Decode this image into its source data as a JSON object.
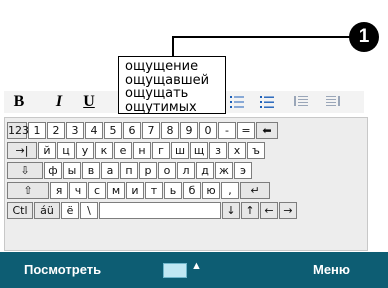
{
  "callout": {
    "number": "1"
  },
  "toolbar": {
    "bold": "B",
    "italic": "I",
    "underline": "U"
  },
  "suggestions": [
    "ощущение",
    "ощущавшей",
    "ощущать",
    "ощутимых"
  ],
  "keyboard": {
    "row1": [
      "123",
      "1",
      "2",
      "3",
      "4",
      "5",
      "6",
      "7",
      "8",
      "9",
      "0",
      "-",
      "=",
      "⬅"
    ],
    "row2": [
      "→|",
      "й",
      "ц",
      "у",
      "к",
      "е",
      "н",
      "г",
      "ш",
      "щ",
      "з",
      "х",
      "ъ"
    ],
    "row3": [
      "⇩",
      "ф",
      "ы",
      "в",
      "а",
      "п",
      "р",
      "о",
      "л",
      "д",
      "ж",
      "э"
    ],
    "row4": [
      "⇧",
      "я",
      "ч",
      "с",
      "м",
      "и",
      "т",
      "ь",
      "б",
      "ю",
      ",",
      "↵"
    ],
    "row5": [
      "Ctl",
      "áü",
      "ё",
      "\\",
      "",
      "↓",
      "↑",
      "←",
      "→"
    ]
  },
  "bottom_bar": {
    "left_label": "Посмотреть",
    "right_label": "Меню",
    "color": "#0d5d73"
  }
}
